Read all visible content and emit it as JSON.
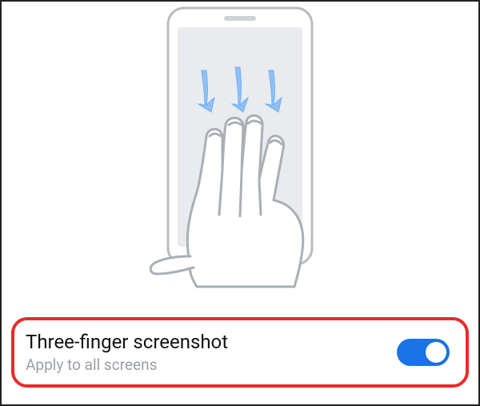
{
  "illustration": {
    "name": "three-finger-swipe-down-illustration"
  },
  "setting": {
    "title": "Three-finger screenshot",
    "subtitle": "Apply to all screens",
    "toggle_on": true,
    "accent_color": "#1a73e8",
    "highlight_color": "#ea2a2a"
  }
}
